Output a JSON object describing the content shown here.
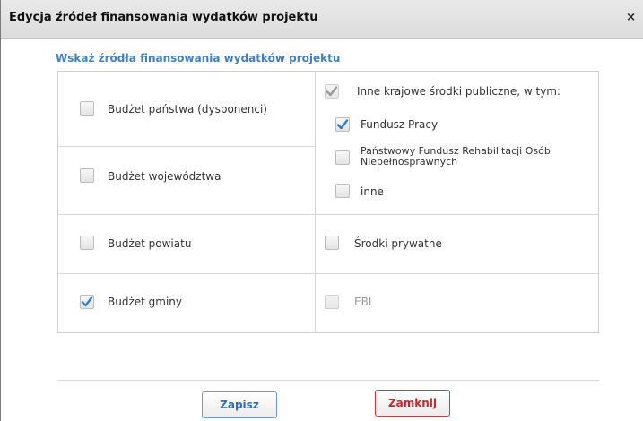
{
  "dialog": {
    "title": "Edycja źródeł finansowania wydatków projektu",
    "close_glyph": "×"
  },
  "subtitle": "Wskaż źródła finansowania wydatków projektu",
  "sources": {
    "budzet_panstwa": {
      "label": "Budżet państwa (dysponenci)",
      "checked": false
    },
    "budzet_wojewodztwa": {
      "label": "Budżet województwa",
      "checked": false
    },
    "budzet_powiatu": {
      "label": "Budżet powiatu",
      "checked": false
    },
    "budzet_gminy": {
      "label": "Budżet gminy",
      "checked": true
    },
    "inne_krajowe": {
      "label": "Inne krajowe środki publiczne, w tym:",
      "checked": true,
      "disabled": true
    },
    "fundusz_pracy": {
      "label": "Fundusz Pracy",
      "checked": true
    },
    "pfron": {
      "label_line1": "Państwowy Fundusz Rehabilitacji Osób",
      "label_line2": "Niepełnosprawnych",
      "checked": false
    },
    "inne": {
      "label": "inne",
      "checked": false
    },
    "srodki_prywatne": {
      "label": "Środki prywatne",
      "checked": false
    },
    "ebi": {
      "label": "EBI",
      "checked": false,
      "disabled": true
    }
  },
  "buttons": {
    "save_label": "Zapisz",
    "close_label": "Zamknij"
  },
  "colors": {
    "accent": "#3d7fcc",
    "check": "#2f7bd9",
    "check_disabled": "#9a9a9a",
    "close_button": "#c8282b"
  }
}
